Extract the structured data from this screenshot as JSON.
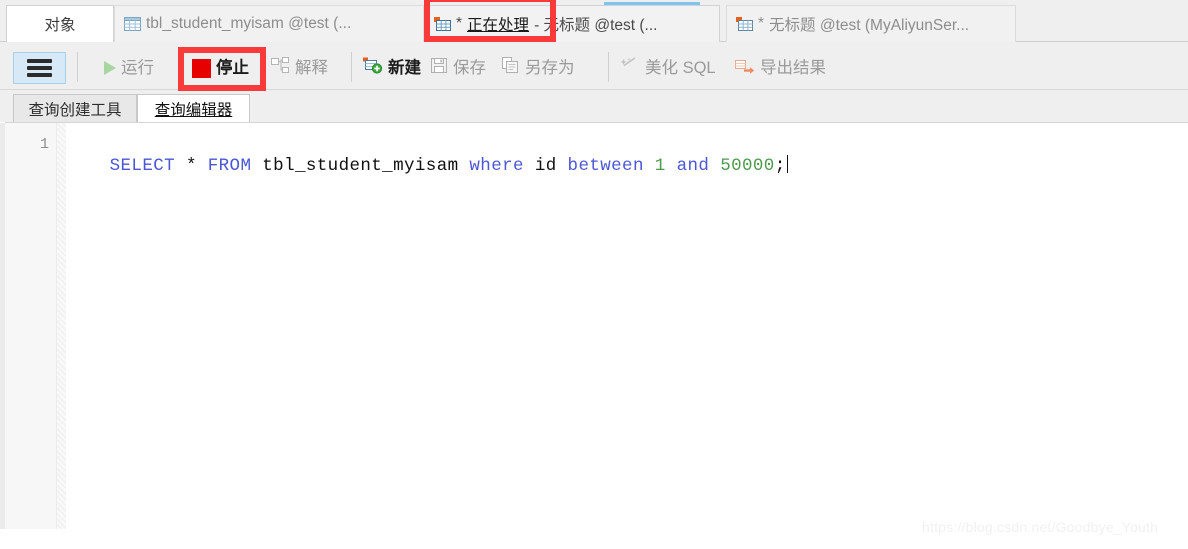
{
  "window": {
    "app_kind": "database-client-query-editor"
  },
  "tabbar": {
    "object_tab_label": "对象",
    "tabs": [
      {
        "id": "tbl-student-myisam",
        "icon": "table-grid-icon",
        "label": "tbl_student_myisam @test (...",
        "state": "inactive"
      },
      {
        "id": "processing-query",
        "icon": "query-table-icon",
        "prefix": "*",
        "label_highlight": "正在处理",
        "label_rest": "- 无标题 @test (...",
        "state": "active-running"
      },
      {
        "id": "untitled-query",
        "icon": "query-table-icon",
        "prefix": "*",
        "label": "无标题 @test (MyAliyunSer...",
        "state": "inactive"
      }
    ]
  },
  "toolbar": {
    "menu_button": "hamburger-menu",
    "items": [
      {
        "id": "run",
        "icon": "play-triangle-icon",
        "label": "运行",
        "enabled": false
      },
      {
        "id": "stop",
        "icon": "stop-square-icon",
        "label": "停止",
        "enabled": true
      },
      {
        "id": "explain",
        "icon": "explain-icon",
        "label": "解释",
        "enabled": false
      },
      {
        "id": "new",
        "icon": "new-query-icon",
        "label": "新建",
        "enabled": true
      },
      {
        "id": "save",
        "icon": "floppy-save-icon",
        "label": "保存",
        "enabled": false
      },
      {
        "id": "save-as",
        "icon": "save-as-icon",
        "label": "另存为",
        "enabled": false
      },
      {
        "id": "beautify",
        "icon": "sparkle-wand-icon",
        "label": "美化 SQL",
        "enabled": false
      },
      {
        "id": "export",
        "icon": "export-arrow-icon",
        "label": "导出结果",
        "enabled": false
      }
    ]
  },
  "subtabs": [
    {
      "id": "query-builder",
      "label": "查询创建工具",
      "active": false
    },
    {
      "id": "query-editor",
      "label": "查询编辑器",
      "active": true
    }
  ],
  "editor": {
    "line_number": "1",
    "tokens": [
      {
        "text": "SELECT",
        "type": "keyword"
      },
      {
        "text": " ",
        "type": "plain"
      },
      {
        "text": "*",
        "type": "punct"
      },
      {
        "text": " ",
        "type": "plain"
      },
      {
        "text": "FROM",
        "type": "keyword"
      },
      {
        "text": " ",
        "type": "plain"
      },
      {
        "text": "tbl_student_myisam",
        "type": "identifier"
      },
      {
        "text": " ",
        "type": "plain"
      },
      {
        "text": "where",
        "type": "keyword"
      },
      {
        "text": " ",
        "type": "plain"
      },
      {
        "text": "id",
        "type": "identifier"
      },
      {
        "text": " ",
        "type": "plain"
      },
      {
        "text": "between",
        "type": "keyword"
      },
      {
        "text": " ",
        "type": "plain"
      },
      {
        "text": "1",
        "type": "number"
      },
      {
        "text": " ",
        "type": "plain"
      },
      {
        "text": "and",
        "type": "keyword"
      },
      {
        "text": " ",
        "type": "plain"
      },
      {
        "text": "50000",
        "type": "number"
      },
      {
        "text": ";",
        "type": "punct"
      }
    ],
    "full_text": "SELECT * FROM tbl_student_myisam where id between 1 and 50000;"
  },
  "annotations": [
    {
      "id": "highlight-processing-tab",
      "shape": "rectangle",
      "color": "#f93a3a"
    },
    {
      "id": "highlight-stop-button",
      "shape": "rectangle",
      "color": "#f93a3a"
    }
  ],
  "watermark": {
    "text": "https://blog.csdn.net/Goodbye_Youth"
  },
  "colors": {
    "annotation_red": "#f93a3a",
    "stop_icon_red": "#e60000",
    "keyword_blue": "#4b57d6",
    "number_green": "#4d9a4d",
    "progress_blue": "#7dc4ef",
    "chrome_gray": "#efefef"
  }
}
